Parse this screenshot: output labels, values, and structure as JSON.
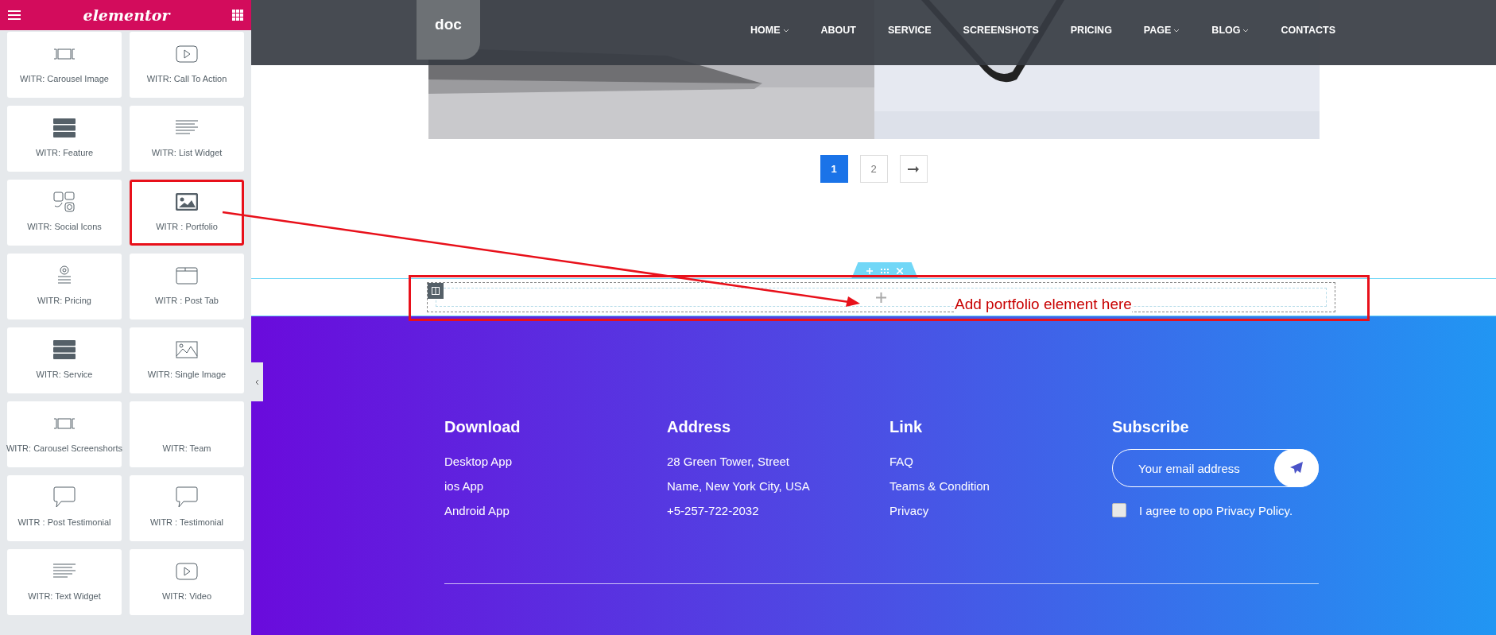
{
  "sidebar": {
    "brand": "elementor",
    "widgets": [
      {
        "label": "WITR: Carousel Image",
        "highlighted": false
      },
      {
        "label": "WITR: Call To Action",
        "highlighted": false
      },
      {
        "label": "WITR: Feature",
        "highlighted": false
      },
      {
        "label": "WITR: List Widget",
        "highlighted": false
      },
      {
        "label": "WITR: Social Icons",
        "highlighted": false
      },
      {
        "label": "WITR : Portfolio",
        "highlighted": true
      },
      {
        "label": "WITR: Pricing",
        "highlighted": false
      },
      {
        "label": "WITR : Post Tab",
        "highlighted": false
      },
      {
        "label": "WITR: Service",
        "highlighted": false
      },
      {
        "label": "WITR: Single Image",
        "highlighted": false
      },
      {
        "label": "WITR: Carousel Screenshorts",
        "highlighted": false
      },
      {
        "label": "WITR: Team",
        "highlighted": false
      },
      {
        "label": "WITR : Post Testimonial",
        "highlighted": false
      },
      {
        "label": "WITR : Testimonial",
        "highlighted": false
      },
      {
        "label": "WITR: Text Widget",
        "highlighted": false
      },
      {
        "label": "WITR: Video",
        "highlighted": false
      }
    ]
  },
  "site": {
    "logo": "doc",
    "nav": [
      {
        "label": "HOME",
        "dropdown": true
      },
      {
        "label": "ABOUT",
        "dropdown": false
      },
      {
        "label": "SERVICE",
        "dropdown": false
      },
      {
        "label": "SCREENSHOTS",
        "dropdown": false
      },
      {
        "label": "PRICING",
        "dropdown": false
      },
      {
        "label": "PAGE",
        "dropdown": true
      },
      {
        "label": "BLOG",
        "dropdown": true
      },
      {
        "label": "CONTACTS",
        "dropdown": false
      }
    ],
    "pagination": [
      {
        "label": "1",
        "selected": true
      },
      {
        "label": "2",
        "selected": false
      }
    ]
  },
  "annotation": {
    "text": "Add portfolio element here"
  },
  "footer": {
    "columns": [
      {
        "heading": "Download",
        "links": [
          "Desktop App",
          "ios App",
          "Android App"
        ]
      },
      {
        "heading": "Address",
        "links": [
          "28 Green Tower, Street",
          "Name, New York City, USA",
          "+5-257-722-2032"
        ]
      },
      {
        "heading": "Link",
        "links": [
          "FAQ",
          "Teams & Condition",
          "Privacy"
        ]
      }
    ],
    "subscribe": {
      "heading": "Subscribe",
      "placeholder": "Your email address",
      "agree_label": "I agree to opo Privacy Policy.",
      "checked": false
    }
  }
}
